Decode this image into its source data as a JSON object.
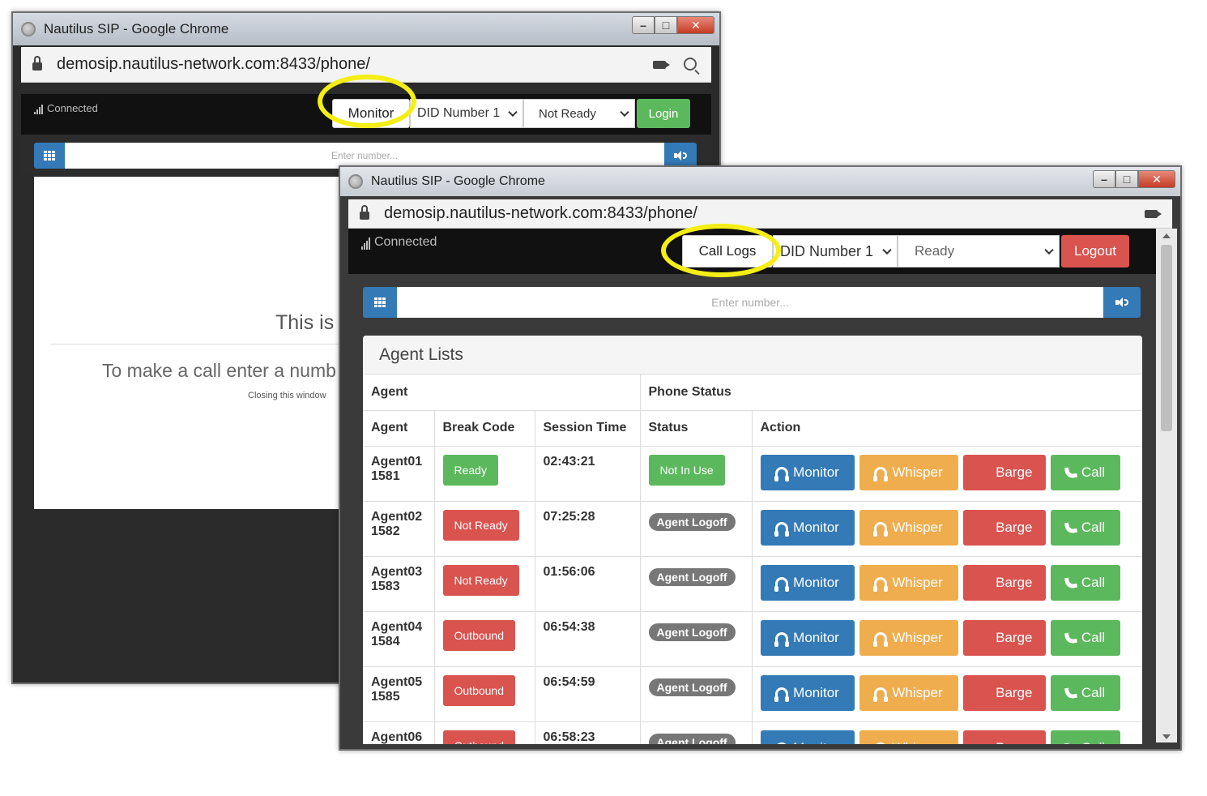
{
  "back_window": {
    "title": "Nautilus SIP - Google Chrome",
    "url": "demosip.nautilus-network.com:8433/phone/",
    "status": "Connected",
    "monitor_label": "Monitor",
    "did_select": "DID Number 1",
    "state_select": "Not Ready",
    "login_label": "Login",
    "number_placeholder": "Enter number...",
    "card_heading": "This is",
    "card_text": "To make a call enter a numb",
    "card_small": "Closing this window"
  },
  "front_window": {
    "title": "Nautilus SIP - Google Chrome",
    "url": "demosip.nautilus-network.com:8433/phone/",
    "status": "Connected",
    "call_logs_label": "Call Logs",
    "did_select": "DID Number 1",
    "state_select": "Ready",
    "logout_label": "Logout",
    "number_placeholder": "Enter number...",
    "panel_title": "Agent Lists",
    "group_headers": [
      "Agent",
      "Phone Status"
    ],
    "columns": [
      "Agent",
      "Break Code",
      "Session Time",
      "Status",
      "Action"
    ],
    "actions": {
      "monitor": "Monitor",
      "whisper": "Whisper",
      "barge": "Barge",
      "call": "Call"
    },
    "rows": [
      {
        "name": "Agent01",
        "ext": "1581",
        "break": "Ready",
        "session": "02:43:21",
        "status": "Not In Use"
      },
      {
        "name": "Agent02",
        "ext": "1582",
        "break": "Not Ready",
        "session": "07:25:28",
        "status": "Agent Logoff"
      },
      {
        "name": "Agent03",
        "ext": "1583",
        "break": "Not Ready",
        "session": "01:56:06",
        "status": "Agent Logoff"
      },
      {
        "name": "Agent04",
        "ext": "1584",
        "break": "Outbound",
        "session": "06:54:38",
        "status": "Agent Logoff"
      },
      {
        "name": "Agent05",
        "ext": "1585",
        "break": "Outbound",
        "session": "06:54:59",
        "status": "Agent Logoff"
      },
      {
        "name": "Agent06",
        "ext": "",
        "break": "Outbound",
        "session": "06:58:23",
        "status": "Agent Logoff"
      }
    ]
  },
  "colors": {
    "highlight": "#f4ee15",
    "green": "#5cb85c",
    "red": "#d9534f",
    "blue": "#337ab7",
    "orange": "#f0ad4e",
    "gray": "#777777"
  }
}
